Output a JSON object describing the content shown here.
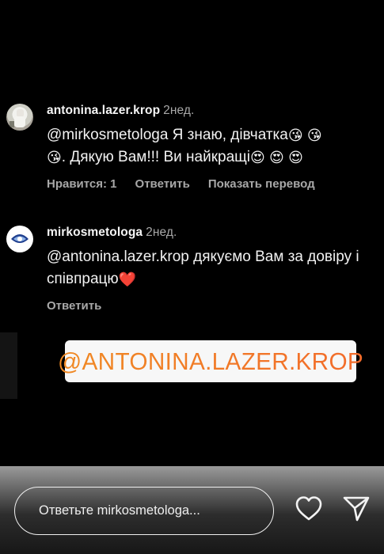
{
  "comments": [
    {
      "username": "antonina.lazer.krop",
      "time": "2нед.",
      "text_before": "@mirkosmetologa Я знаю, дівчатка",
      "text_middle": ". Дякую Вам!!! Ви найкращі",
      "emoji_kiss": "😘",
      "emoji_hearteyes": "😍",
      "likes_label": "Нравится: 1",
      "reply_label": "Ответить",
      "translate_label": "Показать перевод"
    },
    {
      "username": "mirkosmetologa",
      "time": "2нед.",
      "text": "@antonina.lazer.krop дякуємо Вам за довіру і співпрацю",
      "emoji_heart": "❤️",
      "reply_label": "Ответить"
    }
  ],
  "mention_sticker": {
    "text": "@ANTONINA.LAZER.KROP"
  },
  "footer": {
    "reply_placeholder": "Ответьте mirkosmetologa..."
  },
  "icons": {
    "like": "heart-outline-icon",
    "send": "paper-plane-icon"
  },
  "colors": {
    "background": "#000000",
    "mention_gradient_start": "#f08a24",
    "mention_gradient_end": "#f26b2a",
    "secondary_text": "#a8a8a8"
  }
}
